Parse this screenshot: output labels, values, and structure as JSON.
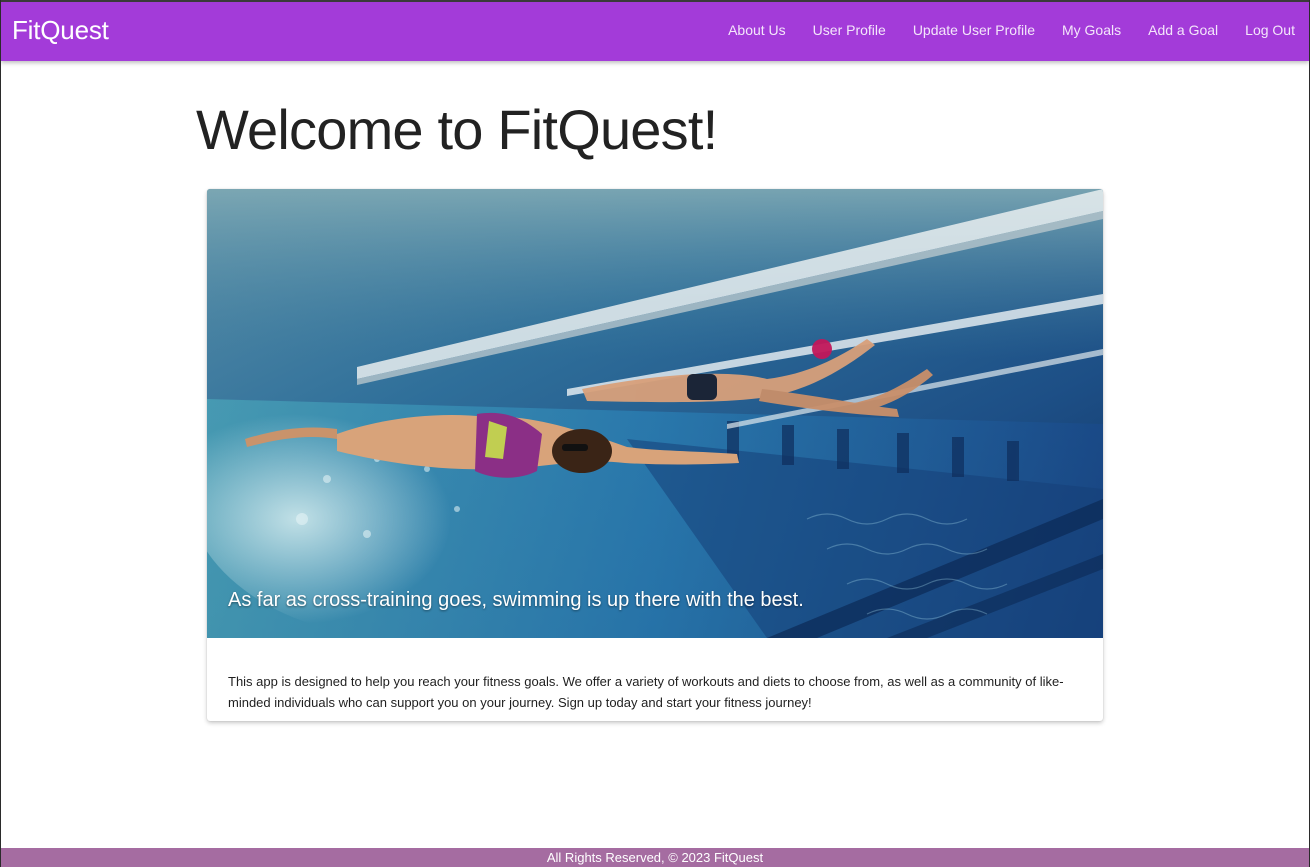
{
  "navbar": {
    "brand": "FitQuest",
    "links": [
      "About Us",
      "User Profile",
      "Update User Profile",
      "My Goals",
      "Add a Goal",
      "Log Out"
    ],
    "background_color": "#a33bd9"
  },
  "main": {
    "title": "Welcome to FitQuest!",
    "card": {
      "image_caption": "As far as cross-training goes, swimming is up there with the best.",
      "body_text": "This app is designed to help you reach your fitness goals. We offer a variety of workouts and diets to choose from, as well as a community of like-minded individuals who can support you on your journey. Sign up today and start your fitness journey!"
    }
  },
  "footer": {
    "text": "All Rights Reserved, © 2023 FitQuest",
    "background_color": "#a56ca1"
  }
}
